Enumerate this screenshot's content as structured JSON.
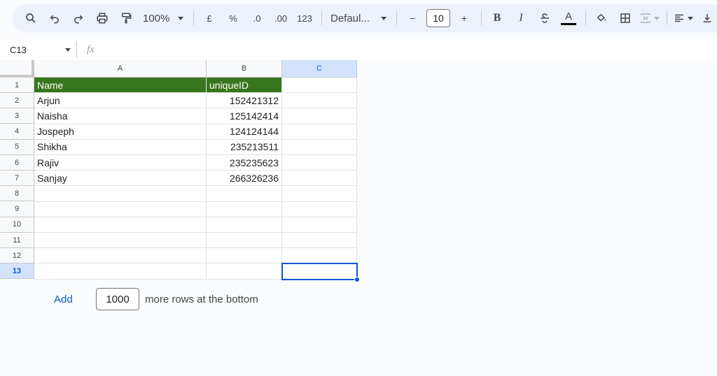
{
  "toolbar": {
    "zoom": "100%",
    "currency": "£",
    "percent": "%",
    "dec_decrease": ".0",
    "dec_increase": ".00",
    "number_format": "123",
    "font": "Defaul...",
    "font_size": "10",
    "minus": "−",
    "plus": "+",
    "bold": "B",
    "italic": "I",
    "text_color_label": "A",
    "icons": [
      "search-icon",
      "undo-icon",
      "redo-icon",
      "print-icon",
      "paint-format-icon",
      "strikethrough-icon",
      "fill-color-icon",
      "borders-icon",
      "merge-icon",
      "align-icon",
      "valign-icon"
    ]
  },
  "formula_bar": {
    "cell_ref": "C13",
    "fx": "fx",
    "value": ""
  },
  "columns": [
    "A",
    "B",
    "C"
  ],
  "rows": [
    "1",
    "2",
    "3",
    "4",
    "5",
    "6",
    "7",
    "8",
    "9",
    "10",
    "11",
    "12",
    "13"
  ],
  "cells": {
    "header": [
      "Name",
      "uniqueID"
    ],
    "data": [
      [
        "Arjun",
        "152421312"
      ],
      [
        "Naisha",
        "125142414"
      ],
      [
        "Jospeph",
        "124124144"
      ],
      [
        "Shikha",
        "235213511"
      ],
      [
        "Rajiv",
        "235235623"
      ],
      [
        "Sanjay",
        "266326236"
      ]
    ]
  },
  "add_rows": {
    "button": "Add",
    "count": "1000",
    "suffix": "more rows at the bottom"
  },
  "colors": {
    "header_fill": "#38761d",
    "accent": "#0b57d0",
    "selected_header": "#d3e3fd"
  }
}
